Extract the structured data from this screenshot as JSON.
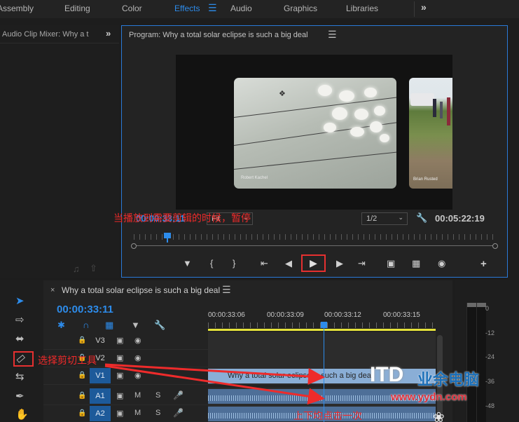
{
  "workspace_tabs": [
    "Assembly",
    "Editing",
    "Color",
    "Effects",
    "Audio",
    "Graphics",
    "Libraries"
  ],
  "active_tab": "Effects",
  "mixer": {
    "title": "Audio Clip Mixer: Why a t"
  },
  "program": {
    "title": "Program: Why a total solar eclipse is such a big deal",
    "timecode_current": "00:00:33:11",
    "timecode_duration": "00:05:22:19",
    "fit_option": "Fit",
    "resolution_option": "1/2",
    "credit_left": "Robert Kachel",
    "credit_right": "Brian Rusted"
  },
  "timeline": {
    "title": "Why a total solar eclipse is such a big deal",
    "timecode": "00:00:33:11",
    "ruler_labels": [
      "00:00:33:06",
      "00:00:33:09",
      "00:00:33:12",
      "00:00:33:15"
    ],
    "clip_label": "Why a total solar eclipse is such a big deal",
    "tracks": [
      {
        "name": "V3",
        "icon2": "eye",
        "s": "",
        "type": "video",
        "active": false
      },
      {
        "name": "V2",
        "icon2": "eye",
        "s": "",
        "type": "video",
        "active": false
      },
      {
        "name": "V1",
        "icon2": "eye",
        "s": "",
        "type": "video",
        "active": true
      },
      {
        "name": "A1",
        "icon2": "M",
        "s": "S",
        "type": "audio",
        "active": true
      },
      {
        "name": "A2",
        "icon2": "M",
        "s": "S",
        "type": "audio",
        "active": true
      }
    ]
  },
  "meters": {
    "labels": [
      "0",
      "-12",
      "-24",
      "-36",
      "-48"
    ]
  },
  "annotations": {
    "play_pause": "当播放到需要剪辑的时候，暂停",
    "razor_tool": "选择剪切工具",
    "up_down": "上下均点击一次"
  },
  "watermark": {
    "logo": "ITD",
    "cn": "业余电脑",
    "url": "www.yydn.com"
  },
  "colors": {
    "accent": "#2d8ceb",
    "annotation": "#ef2a2a",
    "clip_video": "#8aaed6",
    "clip_audio": "#4e6f98"
  }
}
